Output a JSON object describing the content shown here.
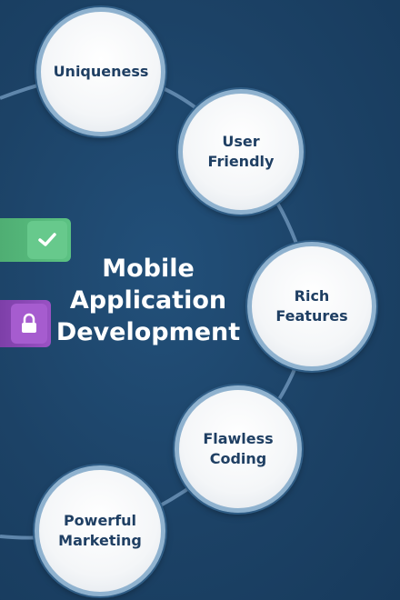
{
  "diagram": {
    "center_title": "Mobile\nApplication\nDevelopment",
    "nodes": [
      {
        "label": "Uniqueness"
      },
      {
        "label": "User\nFriendly"
      },
      {
        "label": "Rich\nFeatures"
      },
      {
        "label": "Flawless\nCoding"
      },
      {
        "label": "Powerful\nMarketing"
      }
    ],
    "icons": {
      "green_tab": "check-icon",
      "purple_tab": "lock-icon"
    }
  },
  "colors": {
    "background": "#1d4468",
    "node_fill": "#ffffff",
    "node_ring": "#8fb2cf",
    "node_text": "#1f3f63",
    "title_text": "#ffffff",
    "green_tab": "#5cc283",
    "purple_tab": "#9a52c4"
  }
}
